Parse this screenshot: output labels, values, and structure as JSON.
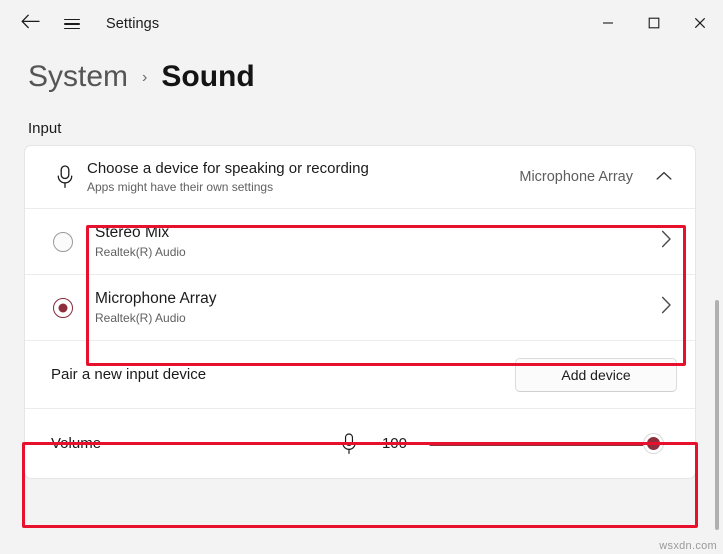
{
  "window": {
    "app_title": "Settings",
    "back_icon": "arrow-left-icon",
    "menu_icon": "hamburger-icon",
    "minimize_label": "—",
    "maximize_label": "□",
    "close_label": "✕"
  },
  "header": {
    "parent": "System",
    "separator": "›",
    "current": "Sound"
  },
  "section": {
    "title": "Input"
  },
  "device_chooser": {
    "title": "Choose a device for speaking or recording",
    "subtitle": "Apps might have their own settings",
    "selected_value": "Microphone Array",
    "icon": "microphone-icon",
    "expand_icon": "chevron-up-icon"
  },
  "devices": [
    {
      "name": "Stereo Mix",
      "driver": "Realtek(R) Audio",
      "selected": false,
      "chevron": "chevron-right-icon"
    },
    {
      "name": "Microphone Array",
      "driver": "Realtek(R) Audio",
      "selected": true,
      "chevron": "chevron-right-icon"
    }
  ],
  "pair": {
    "label": "Pair a new input device",
    "button_label": "Add device"
  },
  "volume": {
    "label": "Volume",
    "icon": "microphone-icon",
    "value": "100"
  },
  "watermark": "wsxdn.com",
  "colors": {
    "accent": "#8e2f3e",
    "annotation": "#e8112d",
    "card_background": "#ffffff",
    "page_background": "#f3f3f3"
  }
}
